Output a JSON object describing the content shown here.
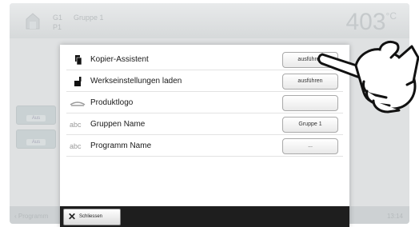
{
  "header": {
    "line1": "G1",
    "line2": "P1",
    "group": "Gruppe 1",
    "temperature": "403",
    "temperature_unit": "°C"
  },
  "side_buttons": [
    "Aus",
    "Aus"
  ],
  "footer": {
    "left_label": "Programm",
    "right_label": "13:14"
  },
  "dialog": {
    "rows": [
      {
        "icon": "copy-icon",
        "label": "Kopier-Assistent",
        "button": "ausführen"
      },
      {
        "icon": "factory-reset-icon",
        "label": "Werkseinstellungen laden",
        "button": "ausführen"
      },
      {
        "icon": "logo-icon",
        "label": "Produktlogo",
        "button": ""
      },
      {
        "icon": "abc-text-icon",
        "icon_text": "abc",
        "label": "Gruppen Name",
        "button": "Gruppe 1"
      },
      {
        "icon": "abc-text-icon",
        "icon_text": "abc",
        "label": "Programm Name",
        "button": "..."
      }
    ],
    "close_label": "Schliessen"
  }
}
